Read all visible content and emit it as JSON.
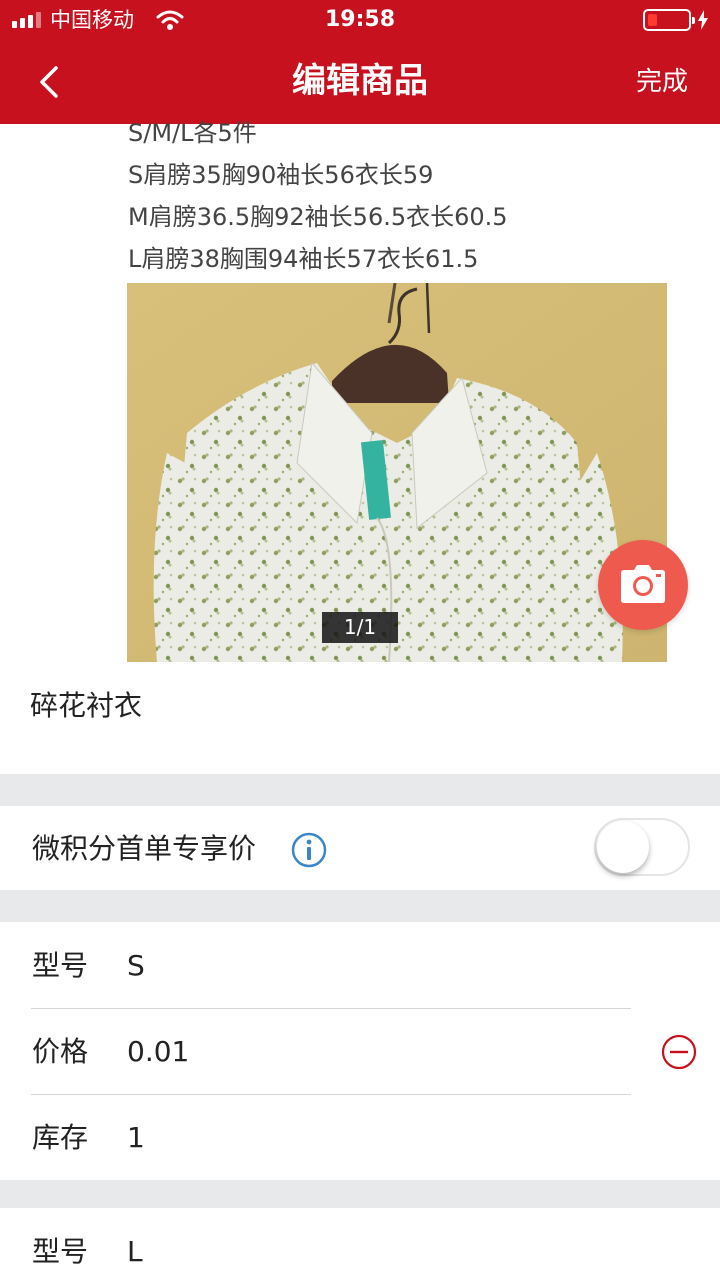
{
  "status_bar": {
    "carrier": "中国移动",
    "time": "19:58"
  },
  "nav": {
    "title": "编辑商品",
    "done_label": "完成",
    "back_icon": "chevron-left-icon"
  },
  "description_lines": [
    "S/M/L各5件",
    "S肩膀35胸90袖长56衣长59",
    "M肩膀36.5胸92袖长56.5衣长60.5",
    "L肩膀38胸围94袖长57衣长61.5"
  ],
  "gallery": {
    "pager": "1/1",
    "camera_icon": "camera-icon"
  },
  "product_name": "碎花衬衣",
  "first_order_price": {
    "label": "微积分首单专享价",
    "enabled": false,
    "info_icon": "info-icon"
  },
  "specs": [
    {
      "model_label": "型号",
      "model": "S",
      "price_label": "价格",
      "price": "0.01",
      "stock_label": "库存",
      "stock": "1"
    },
    {
      "model_label": "型号",
      "model": "L"
    }
  ],
  "colors": {
    "brand_red": "#c8111e",
    "camera_button": "#ee5a4e",
    "info_blue": "#3d86c6",
    "minus_red": "#c8111e",
    "section_gap": "#e8e9ea"
  }
}
